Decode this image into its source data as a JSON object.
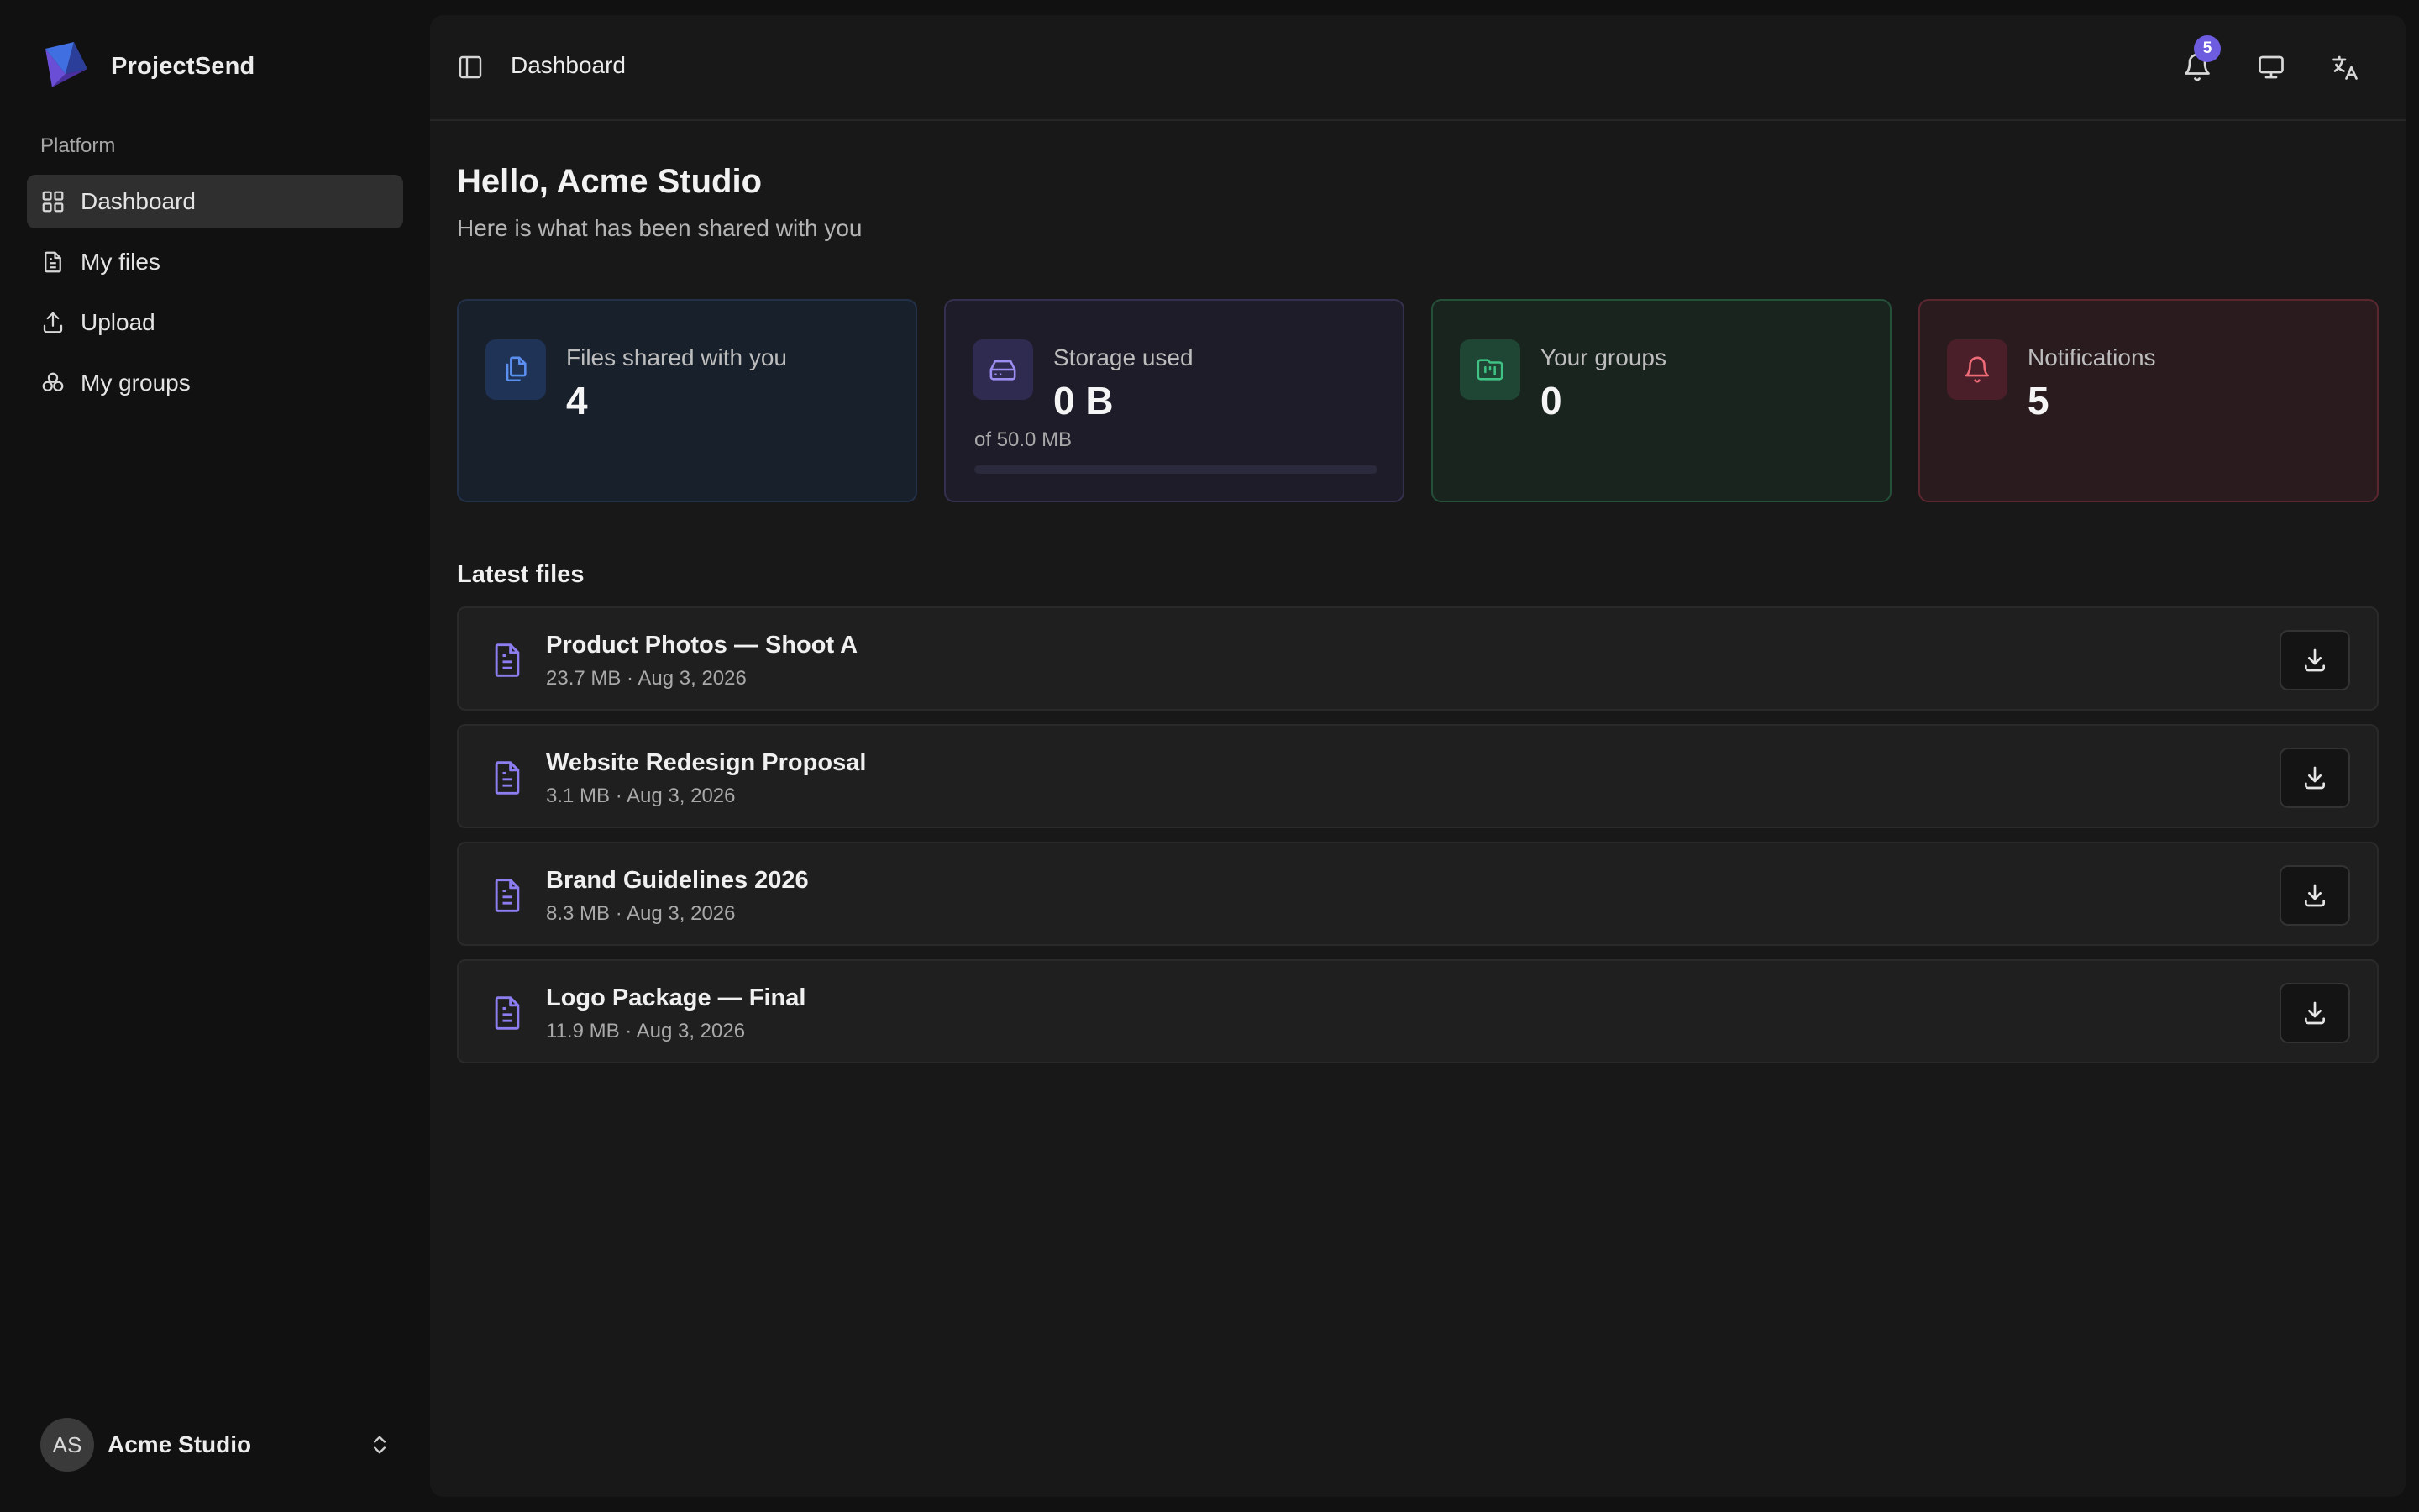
{
  "app": {
    "name": "ProjectSend"
  },
  "sidebar": {
    "section_label": "Platform",
    "items": [
      {
        "label": "Dashboard",
        "icon": "grid-icon",
        "active": true
      },
      {
        "label": "My files",
        "icon": "file-icon",
        "active": false
      },
      {
        "label": "Upload",
        "icon": "upload-icon",
        "active": false
      },
      {
        "label": "My groups",
        "icon": "groups-icon",
        "active": false
      }
    ],
    "user": {
      "initials": "AS",
      "name": "Acme Studio"
    }
  },
  "header": {
    "breadcrumb": "Dashboard",
    "notification_count": "5"
  },
  "greeting": {
    "title": "Hello, Acme Studio",
    "subtitle": "Here is what has been shared with you"
  },
  "stats": {
    "files": {
      "label": "Files shared with you",
      "value": "4",
      "color": "#5b8ff0"
    },
    "storage": {
      "label": "Storage used",
      "value": "0 B",
      "sub": "of 50.0 MB",
      "progress": 0,
      "color": "#9b8ef0"
    },
    "groups": {
      "label": "Your groups",
      "value": "0",
      "color": "#3fc283"
    },
    "notifications": {
      "label": "Notifications",
      "value": "5",
      "color": "#ef6b78"
    }
  },
  "latest": {
    "title": "Latest files",
    "files": [
      {
        "name": "Product Photos — Shoot A",
        "meta": "23.7 MB · Aug 3, 2026"
      },
      {
        "name": "Website Redesign Proposal",
        "meta": "3.1 MB · Aug 3, 2026"
      },
      {
        "name": "Brand Guidelines 2026",
        "meta": "8.3 MB · Aug 3, 2026"
      },
      {
        "name": "Logo Package — Final",
        "meta": "11.9 MB · Aug 3, 2026"
      }
    ]
  }
}
